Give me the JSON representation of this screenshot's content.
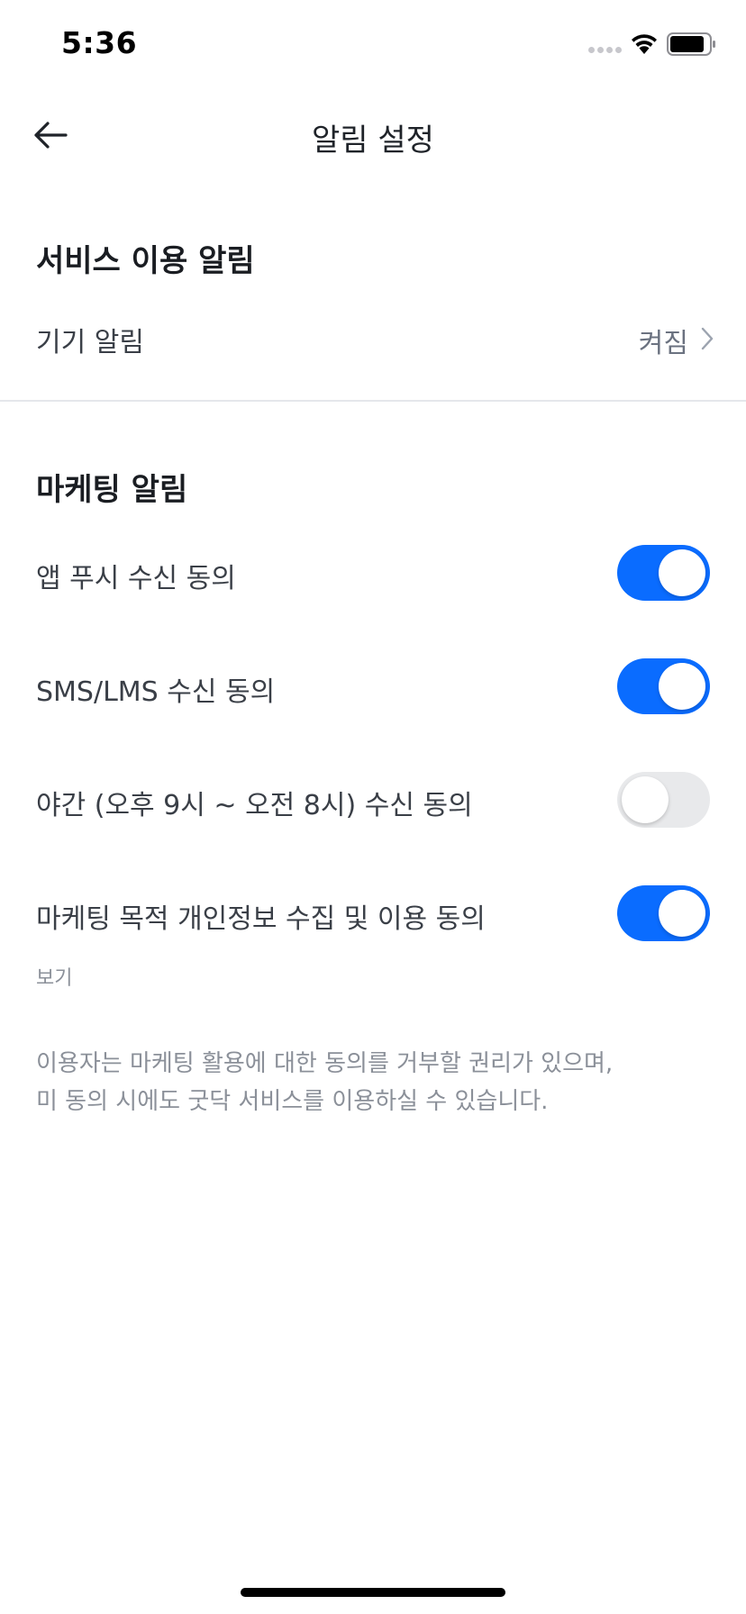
{
  "status_bar": {
    "time": "5:36"
  },
  "header": {
    "title": "알림 설정"
  },
  "service_section": {
    "title": "서비스 이용 알림",
    "device_notification": {
      "label": "기기 알림",
      "value": "켜짐"
    }
  },
  "marketing_section": {
    "title": "마케팅 알림",
    "items": [
      {
        "label": "앱 푸시 수신 동의",
        "enabled": true
      },
      {
        "label": "SMS/LMS 수신 동의",
        "enabled": true
      },
      {
        "label": "야간 (오후 9시 ~ 오전 8시) 수신 동의",
        "enabled": false
      },
      {
        "label": "마케팅 목적 개인정보 수집 및 이용 동의",
        "enabled": true
      }
    ],
    "view_link": "보기"
  },
  "notice": {
    "line1": "이용자는 마케팅 활용에 대한 동의를 거부할 권리가 있으며,",
    "line2": "미 동의 시에도 굿닥 서비스를 이용하실 수 있습니다."
  },
  "colors": {
    "accent": "#0a6cff",
    "toggle_off": "#e8e9eb",
    "muted_text": "#8b9099"
  },
  "icons": [
    "back-arrow-icon",
    "chevron-right-icon",
    "wifi-icon",
    "battery-icon",
    "signal-icon"
  ]
}
